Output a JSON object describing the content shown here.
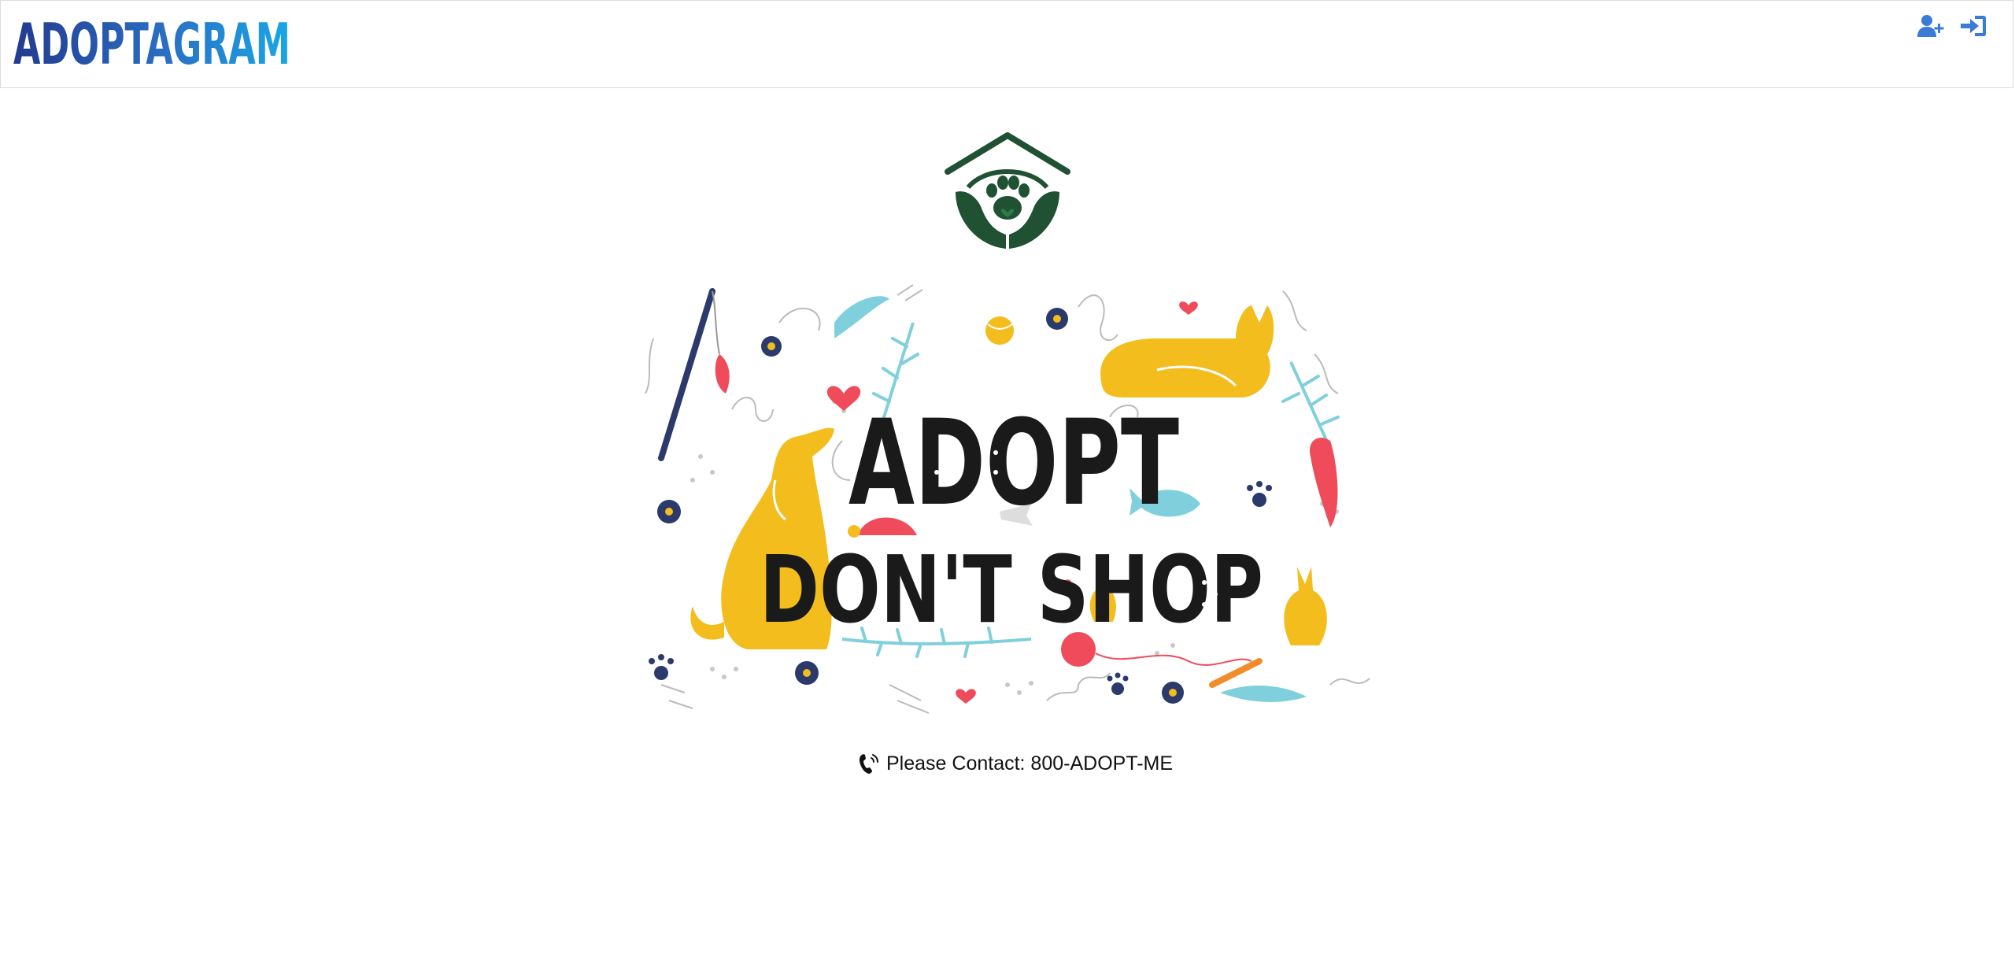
{
  "brand": {
    "name": "ADOPTAGRAM"
  },
  "nav": {
    "signup_icon": "user-plus-icon",
    "login_icon": "sign-in-icon",
    "icon_color": "#3a7bd5"
  },
  "hero": {
    "logo_icon": "paw-house-hands-icon",
    "logo_color": "#1f5132"
  },
  "banner": {
    "line1": "ADOPT",
    "line2": "DON'T SHOP",
    "colors": {
      "yellow": "#f2bd1d",
      "teal": "#7fd0dc",
      "navy": "#2b3a6b",
      "red": "#ef4b5a",
      "ink": "#1a1a1a"
    }
  },
  "contact": {
    "icon": "phone-volume-icon",
    "text": "Please Contact: 800-ADOPT-ME"
  }
}
